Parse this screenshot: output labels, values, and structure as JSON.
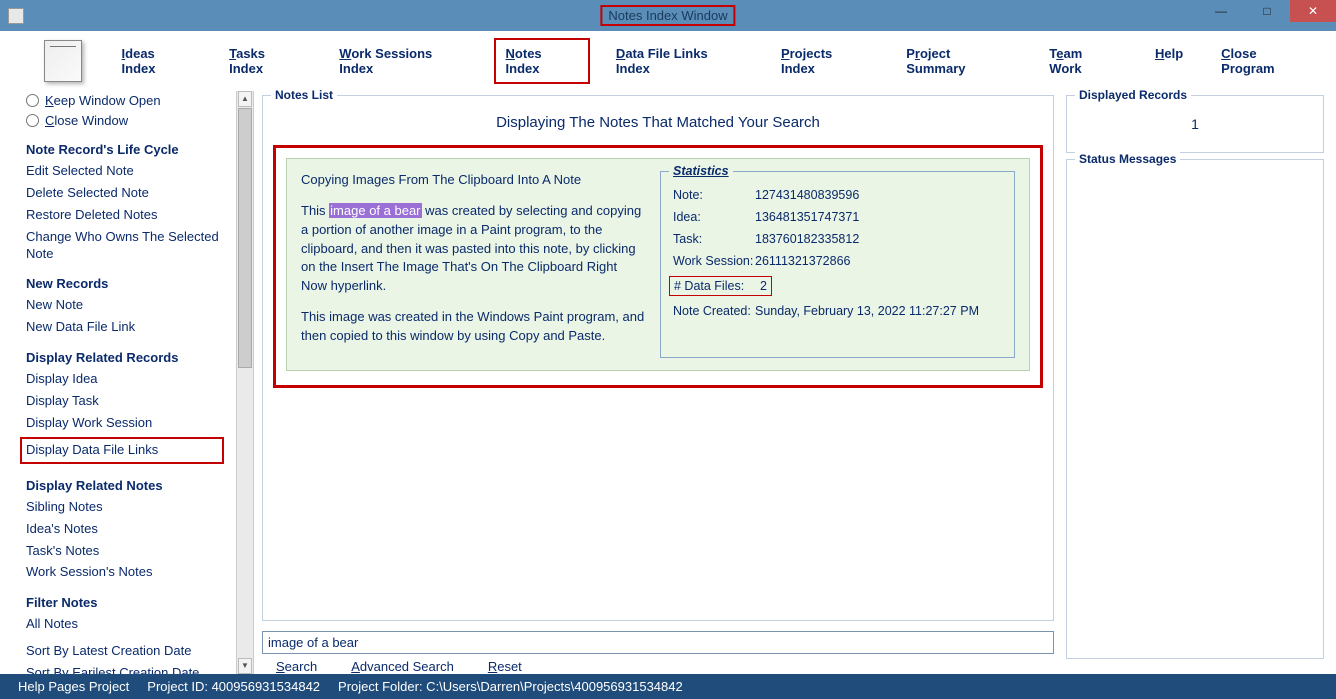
{
  "titlebar": {
    "title": "Notes Index Window"
  },
  "nav": {
    "ideas": "Ideas Index",
    "tasks": "Tasks Index",
    "work_sessions": "Work Sessions Index",
    "notes": "Notes Index",
    "datafile": "Data File Links Index",
    "projects": "Projects Index",
    "summary": "Project Summary",
    "team": "Team Work",
    "help": "Help",
    "close": "Close Program"
  },
  "sidebar": {
    "keep_open": "Keep Window Open",
    "close_window": "Close Window",
    "h_lifecycle": "Note Record's Life Cycle",
    "edit_note": "Edit Selected Note",
    "delete_note": "Delete Selected Note",
    "restore_notes": "Restore Deleted Notes",
    "change_owner": "Change Who Owns The Selected Note",
    "h_new": "New Records",
    "new_note": "New Note",
    "new_dfl": "New Data File Link",
    "h_related": "Display Related Records",
    "disp_idea": "Display Idea",
    "disp_task": "Display Task",
    "disp_ws": "Display Work Session",
    "disp_dfl": "Display Data File Links",
    "h_related_notes": "Display Related Notes",
    "sibling": "Sibling Notes",
    "ideas_notes": "Idea's Notes",
    "tasks_notes": "Task's Notes",
    "ws_notes": "Work Session's Notes",
    "h_filter": "Filter Notes",
    "all_notes": "All Notes",
    "sort_latest": "Sort By Latest Creation Date",
    "sort_earliest": "Sort By Earilest Creation Date"
  },
  "notes_list": {
    "legend": "Notes List",
    "heading": "Displaying The Notes That Matched Your Search",
    "note_title": "Copying Images From The Clipboard Into A Note",
    "body_prefix": "This ",
    "body_highlight": "image of a bear",
    "body_after_hl": " was created by selecting and copying a portion of another image in a Paint program, to the clipboard, and then it was pasted into this note, by clicking on the Insert The Image That's On The Clipboard Right Now hyperlink.",
    "body_p2": "This image was created in the Windows Paint program, and then copied to this window by using Copy and Paste."
  },
  "stats": {
    "legend": "Statistics",
    "note_l": "Note:",
    "note_v": "127431480839596",
    "idea_l": "Idea:",
    "idea_v": "136481351747371",
    "task_l": "Task:",
    "task_v": "183760182335812",
    "ws_l": "Work Session:",
    "ws_v": "26111321372866",
    "df_l": "# Data Files:",
    "df_v": "2",
    "created_l": "Note Created:",
    "created_v": "Sunday, February 13, 2022  11:27:27 PM"
  },
  "search": {
    "value": "image of a bear",
    "search": "Search",
    "advanced": "Advanced Search",
    "reset": "Reset"
  },
  "right": {
    "disp_legend": "Displayed Records",
    "disp_value": "1",
    "status_legend": "Status Messages"
  },
  "statusbar": {
    "project_name": "Help Pages Project",
    "project_id": "Project ID: 400956931534842",
    "project_folder": "Project Folder: C:\\Users\\Darren\\Projects\\400956931534842"
  }
}
